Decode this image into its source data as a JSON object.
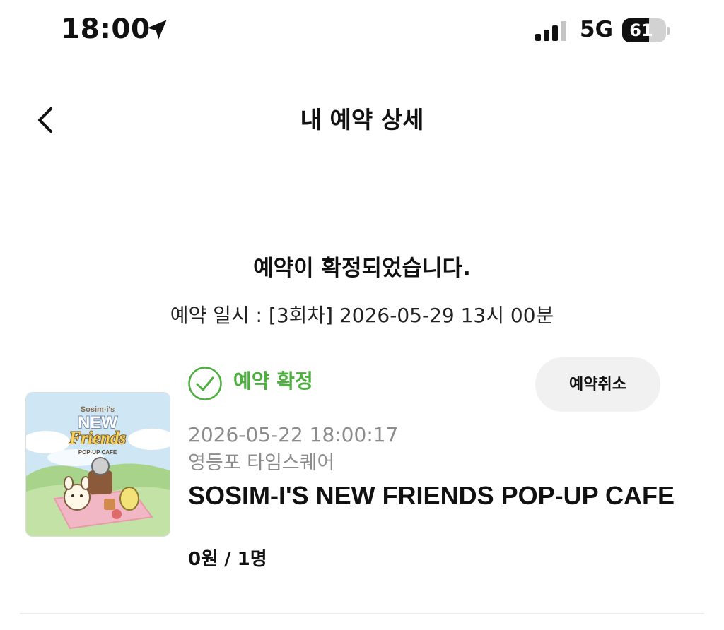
{
  "status_bar": {
    "time": "18:00",
    "location_icon": "location-arrow-icon",
    "signal_icon": "cellular-signal-icon",
    "network": "5G",
    "battery": "61",
    "battery_level": 0.61
  },
  "header": {
    "back_icon": "chevron-left-icon",
    "title": "내 예약 상세"
  },
  "confirmation": {
    "heading": "예약이 확정되었습니다.",
    "datetime": "예약 일시 : [3회차] 2026-05-29 13시 00분"
  },
  "booking": {
    "thumbnail": {
      "logo_small": "Sosim-i's",
      "logo_line1": "NEW",
      "logo_line2": "Friends",
      "logo_sub": "POP-UP CAFE"
    },
    "status_icon": "check-circle-icon",
    "status": "예약 확정",
    "status_color": "#4caf3e",
    "cancel_label": "예약취소",
    "booked_at": "2026-05-22 18:00:17",
    "venue": "영등포 타임스퀘어",
    "title": "SOSIM-I'S NEW FRIENDS POP-UP CAFE",
    "price_qty": "0원 / 1명"
  }
}
